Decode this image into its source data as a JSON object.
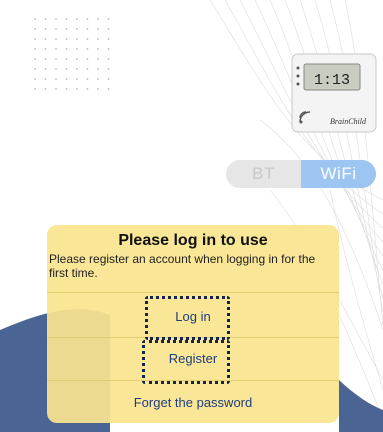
{
  "toggle": {
    "bt_label": "BT",
    "wifi_label": "WiFi",
    "selected": "WiFi"
  },
  "device": {
    "display_reading": "1:13",
    "brand": "BrainChild"
  },
  "login_card": {
    "title": "Please log in to use",
    "subtitle": "Please register an account when logging in for the first time.",
    "login_label": "Log in",
    "register_label": "Register",
    "forgot_label": "Forget the password"
  },
  "colors": {
    "card_bg": "#f7e28e",
    "link": "#1f3d80",
    "toggle_active": "#9cc5f2",
    "wave_blue": "#4a6594",
    "highlight_border": "#16244a"
  }
}
